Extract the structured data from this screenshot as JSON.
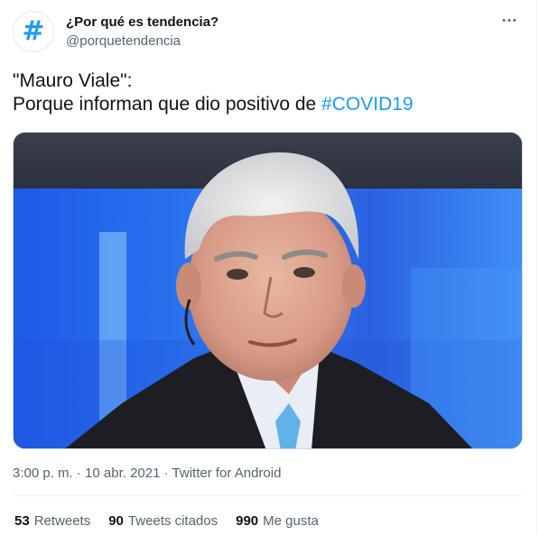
{
  "account": {
    "display_name": "¿Por qué es tendencia?",
    "handle": "@porquetendencia",
    "avatar_glyph": "#",
    "avatar_color": "#1d9bf0"
  },
  "more_menu": {
    "icon": "more-dots-icon",
    "glyph": "•••"
  },
  "tweet": {
    "line1": "\"Mauro Viale\":",
    "line2_prefix": "Porque informan que dio positivo de ",
    "hashtag": "#COVID19"
  },
  "media": {
    "alt": "",
    "background_color": "#1f4fd6"
  },
  "meta": {
    "time": "3:00 p. m.",
    "separator": " · ",
    "date": "10 abr. 2021",
    "source": "Twitter for Android"
  },
  "stats": {
    "retweets_count": "53",
    "retweets_label": "Retweets",
    "quotes_count": "90",
    "quotes_label": "Tweets citados",
    "likes_count": "990",
    "likes_label": "Me gusta"
  },
  "colors": {
    "accent": "#1d9bf0",
    "text_primary": "#0f1419",
    "text_secondary": "#536471"
  }
}
